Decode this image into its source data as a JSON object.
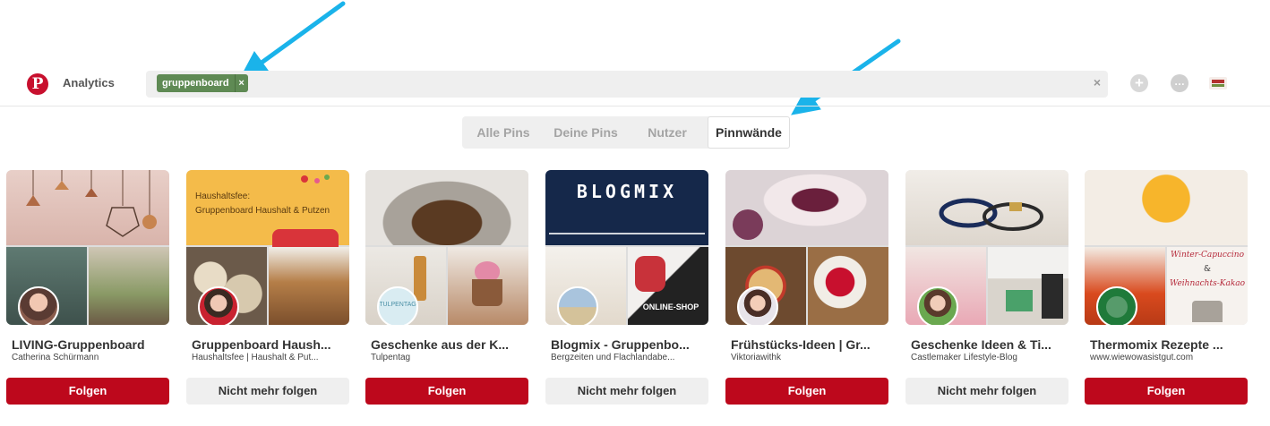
{
  "header": {
    "logo_letter": "P",
    "analytics_label": "Analytics",
    "search": {
      "chip_label": "gruppenboard",
      "chip_remove": "×",
      "clear": "×"
    },
    "add_symbol": "+",
    "messages_symbol": "…"
  },
  "tabs": [
    {
      "label": "Alle Pins",
      "active": false
    },
    {
      "label": "Deine Pins",
      "active": false
    },
    {
      "label": "Nutzer",
      "active": false
    },
    {
      "label": "Pinnwände",
      "active": true
    }
  ],
  "boards": [
    {
      "title": "LIVING-Gruppenboard",
      "owner": "Catherina Schürmann",
      "button": "Folgen",
      "following": false
    },
    {
      "title": "Gruppenboard Haush...",
      "owner": "Haushaltsfee | Haushalt & Put...",
      "button": "Nicht mehr folgen",
      "following": true,
      "banner_line1": "Haushaltsfee:",
      "banner_line2": "Gruppenboard Haushalt & Putzen"
    },
    {
      "title": "Geschenke aus der K...",
      "owner": "Tulpentag",
      "button": "Folgen",
      "following": false,
      "avatar_text": "TULPENTAG"
    },
    {
      "title": "Blogmix - Gruppenbo...",
      "owner": "Bergzeiten und Flachlandabe...",
      "button": "Nicht mehr folgen",
      "following": true,
      "banner_text": "BLOGMIX",
      "shop_text": "ONLINE-SHOP"
    },
    {
      "title": "Frühstücks-Ideen | Gr...",
      "owner": "Viktoriawithk",
      "button": "Folgen",
      "following": false
    },
    {
      "title": "Geschenke Ideen & Ti...",
      "owner": "Castlemaker Lifestyle-Blog",
      "button": "Nicht mehr folgen",
      "following": true
    },
    {
      "title": "Thermomix Rezepte ...",
      "owner": "www.wiewowasistgut.com",
      "button": "Folgen",
      "following": false,
      "caption_line1": "Winter-Capuccino",
      "caption_line2": "&",
      "caption_line3": "Weihnachts-Kakao"
    }
  ],
  "colors": {
    "follow_red": "#bd081c",
    "arrow_blue": "#1ab3ea",
    "chip_green": "#5f8a54"
  }
}
